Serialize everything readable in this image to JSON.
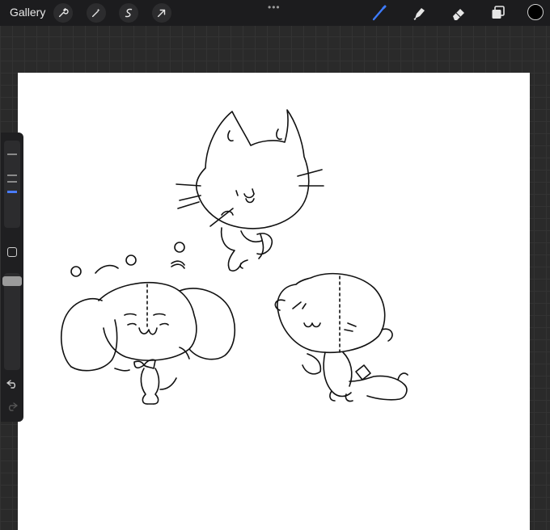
{
  "topbar": {
    "gallery_label": "Gallery",
    "more_dots": "•••",
    "left_tools": [
      "wrench-icon",
      "magic-wand-icon",
      "selection-s-icon",
      "transform-arrow-icon"
    ],
    "right_tools": [
      "brush-icon",
      "smudge-icon",
      "eraser-icon",
      "layers-icon"
    ],
    "active_tool_color": "#3d7bff",
    "color_well": "#000000"
  },
  "sidebar": {
    "brush_size_level": 0.32,
    "opacity_level": 0.93,
    "icons": [
      "modify-square-icon",
      "undo-icon",
      "redo-icon"
    ]
  },
  "canvas": {
    "background": "#ffffff",
    "drawings": [
      "cat-doodle",
      "puppy-doodle",
      "bear-doodle"
    ]
  }
}
